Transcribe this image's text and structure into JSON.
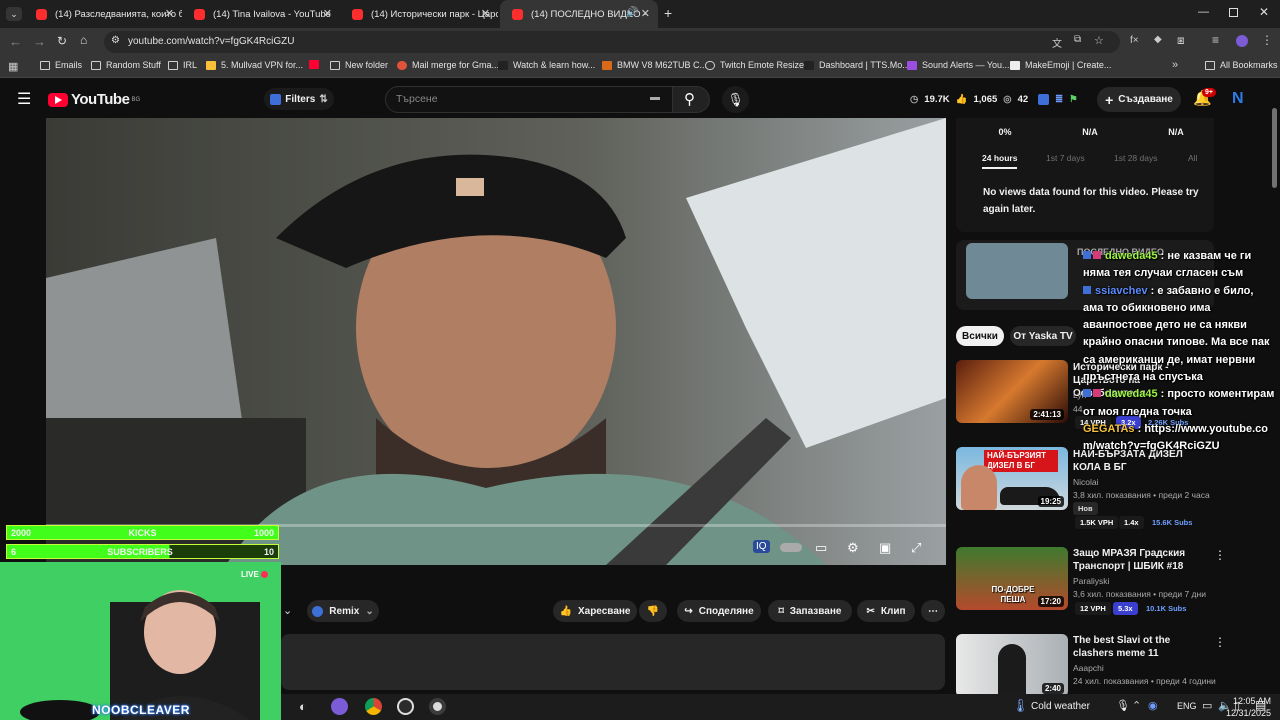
{
  "browser": {
    "tabs": [
      {
        "title": "(14) Разследванията, които бе",
        "active": false
      },
      {
        "title": "(14) Tina Ivailova - YouTube",
        "active": false
      },
      {
        "title": "(14) Исторически парк - Царс",
        "active": false
      },
      {
        "title": "(14) ПОСЛЕДНО ВИДЕО -",
        "active": true
      }
    ],
    "url": "youtube.com/watch?v=fgGK4RciGZU",
    "bookmarks": [
      "Emails",
      "Random Stuff",
      "IRL",
      "5. Mullvad VPN for...",
      "New folder",
      "Mail merge for Gma...",
      "Watch & learn how...",
      "BMW V8 M62TUB C...",
      "Twitch Emote Resizer",
      "Dashboard | TTS.Mo...",
      "Sound Alerts — You...",
      "MakeEmoji | Create..."
    ],
    "all_bookmarks": "All Bookmarks"
  },
  "youtube": {
    "logo": "YouTube",
    "region": "BG",
    "filters": "Filters",
    "search_placeholder": "Търсене",
    "stats": {
      "views": "19.7K",
      "likes": "1,065",
      "comments": "42"
    },
    "create": "Създаване",
    "notif_count": "9+"
  },
  "player": {
    "actions": {
      "remix": "Remix",
      "like": "Харесване",
      "share": "Споделяне",
      "save": "Запазване",
      "clip": "Клип"
    }
  },
  "overlay": {
    "kicks": {
      "left": "2000",
      "label": "KICKS",
      "right": "1000"
    },
    "subs": {
      "left": "6",
      "label": "SUBSCRIBERS",
      "right": "10"
    },
    "live": "LIVE",
    "streamer": "NOOBCLEAVER"
  },
  "right": {
    "stats": [
      "0%",
      "N/A",
      "N/A"
    ],
    "ranges": [
      "24 hours",
      "1st 7 days",
      "1st 28 days",
      "All"
    ],
    "no_data": "No views data found for this video. Please try again later.",
    "current_title": "ПОСЛЕДНО ВИДЕО",
    "chips": [
      "Всички",
      "От Yaska TV"
    ],
    "videos": [
      {
        "title": "Исторически парк - Царството на Освободителя",
        "channel": "Lyn",
        "meta": "44",
        "duration": "2:41:13",
        "vph": "14 VPH",
        "ratio": "3.2x",
        "subs": "2.26K Subs"
      },
      {
        "title": "НАЙ-БЪРЗАТА ДИЗЕЛ КОЛА В БГ",
        "channel": "Nicolai",
        "meta": "3,8 хил. показвания • преди 2 часа",
        "duration": "19:25",
        "tag": "Нов",
        "vph": "1.5K VPH",
        "ratio": "1.4x",
        "subs": "15.6K Subs",
        "thumb_text": "НАЙ-БЪРЗИЯТ ДИЗЕЛ В БГ"
      },
      {
        "title": "Защо МРАЗЯ Градския Транспорт | ШБИК #18",
        "channel": "Paraliyski",
        "meta": "3,6 хил. показвания • преди 7 дни",
        "duration": "17:20",
        "vph": "12 VPH",
        "ratio": "5.3x",
        "subs": "10.1K Subs",
        "thumb_text": "ПО-ДОБРЕ ПЕША"
      },
      {
        "title": "The best Slavi ot the clashers meme 11",
        "channel": "Aaapchi",
        "meta": "24 хил. показвания • преди 4 години",
        "duration": "2:40"
      }
    ]
  },
  "chat": [
    {
      "user": "daweda45",
      "text": "не казвам че ги няма тея случаи сгласен съм"
    },
    {
      "user": "ssiavchev",
      "text": "е забавно е било, ама то обикновено има аванпостове дето не са някви крайно опасни типове. Ма все пак са американци де, имат нервни пръстчета на спусъка"
    },
    {
      "user": "daweda45",
      "text": "просто коментирам от моя гледна точка"
    },
    {
      "user": "GEGATAs",
      "text": "https://www.youtube.com/watch?v=fgGK4RciGZU"
    }
  ],
  "taskbar": {
    "weather": "Cold weather",
    "lang": "ENG",
    "time": "12:05 AM",
    "date": "12/31/2025"
  },
  "colors": {
    "accent": "#ff0033",
    "bar_green": "#42ff1b",
    "chat_name": "#9ef542"
  }
}
